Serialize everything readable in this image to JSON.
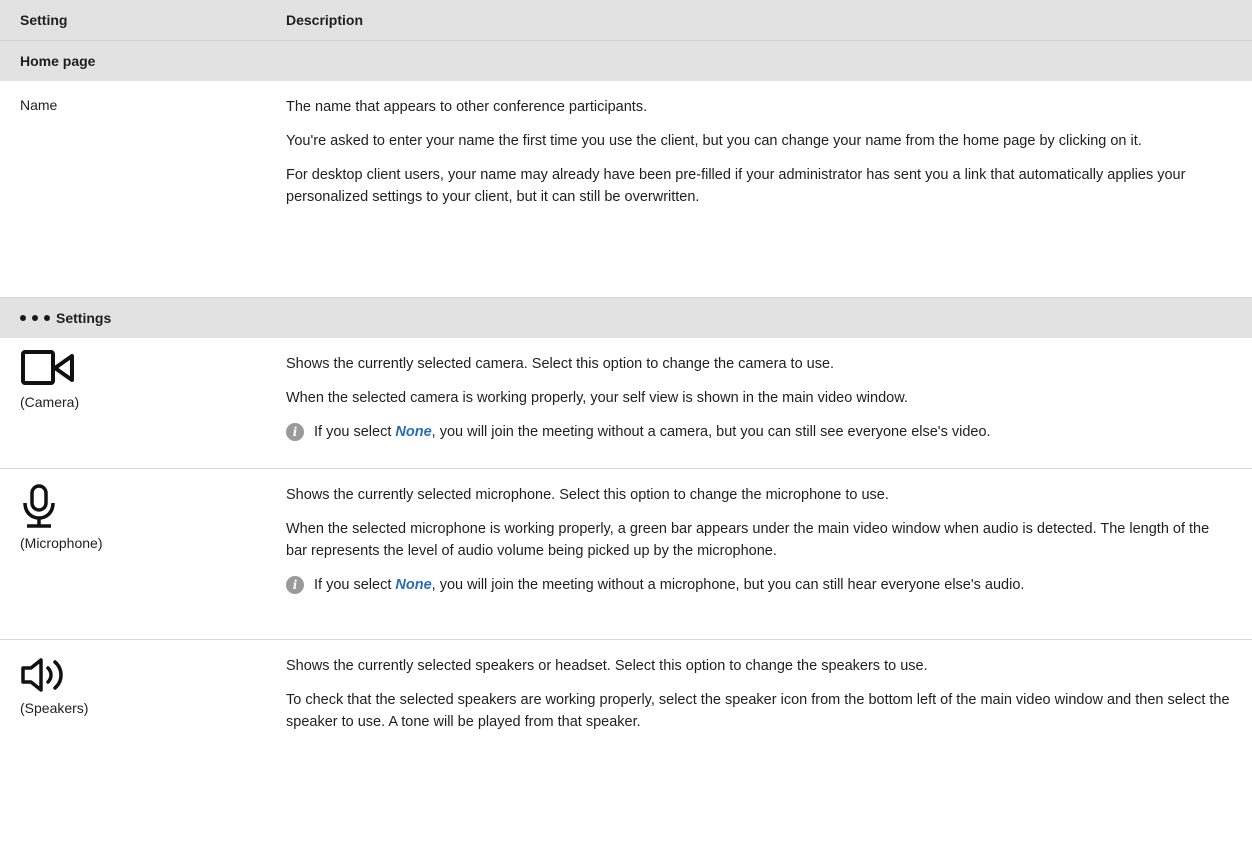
{
  "header": {
    "col1": "Setting",
    "col2": "Description"
  },
  "home_section": {
    "title": "Home page"
  },
  "name_row": {
    "label": "Name",
    "p1": "The name that appears to other conference participants.",
    "p2": "You're asked to enter your name the first time you use the client, but you can change your name from the home page by clicking on it.",
    "p3": "For desktop client users, your name may already have been pre-filled if your administrator has sent you a link that automatically applies your personalized settings to your client, but it can still be overwritten."
  },
  "settings_section": {
    "title": "Settings"
  },
  "camera_row": {
    "caption": "(Camera)",
    "icon": "video-camera-icon",
    "p1": "Shows the currently selected camera. Select this option to change the camera to use.",
    "p2": "When the selected camera is working properly, your self view is shown in the main video window.",
    "note_pre": "If you select ",
    "note_kw": "None",
    "note_post": ", you will join the meeting without a camera, but you can still see everyone else's video."
  },
  "microphone_row": {
    "caption": "(Microphone)",
    "icon": "microphone-icon",
    "p1": "Shows the currently selected microphone. Select this option to change the microphone to use.",
    "p2": "When the selected microphone is working properly, a green bar appears under the main video window when audio is detected. The length of the bar represents the level of audio volume being picked up by the microphone.",
    "note_pre": "If you select ",
    "note_kw": "None",
    "note_post": ", you will join the meeting without a microphone, but you can still hear everyone else's audio."
  },
  "speakers_row": {
    "caption": "(Speakers)",
    "icon": "speaker-icon",
    "p1": "Shows the currently selected speakers or headset. Select this option to change the speakers to use.",
    "p2": "To check that the selected speakers are working properly, select the speaker icon from the bottom left of the main video window and then select the speaker to use. A tone will be played from that speaker."
  },
  "colors": {
    "header_bg": "#e2e2e2",
    "keyword": "#2a6db0",
    "info_icon": "#9a9a9a"
  }
}
